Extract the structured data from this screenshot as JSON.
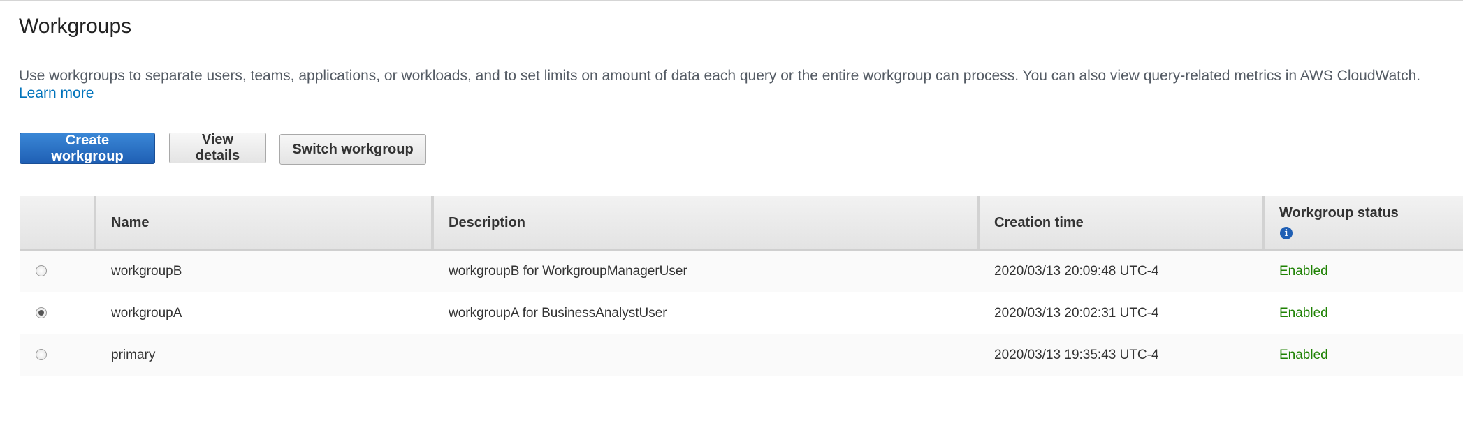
{
  "page": {
    "title": "Workgroups",
    "description": "Use workgroups to separate users, teams, applications, or workloads, and to set limits on amount of data each query or the entire workgroup can process. You can also view query-related metrics in AWS CloudWatch.",
    "learn_more": "Learn more"
  },
  "toolbar": {
    "create_label": "Create workgroup",
    "view_label": "View details",
    "switch_label": "Switch workgroup"
  },
  "table": {
    "columns": [
      "",
      "Name",
      "Description",
      "Creation time",
      "Workgroup status"
    ],
    "info_icon": "info-icon",
    "rows": [
      {
        "selected": false,
        "name": "workgroupB",
        "description": "workgroupB for WorkgroupManagerUser",
        "created": "2020/03/13 20:09:48 UTC-4",
        "status": "Enabled"
      },
      {
        "selected": true,
        "name": "workgroupA",
        "description": "workgroupA for BusinessAnalystUser",
        "created": "2020/03/13 20:02:31 UTC-4",
        "status": "Enabled"
      },
      {
        "selected": false,
        "name": "primary",
        "description": "",
        "created": "2020/03/13 19:35:43 UTC-4",
        "status": "Enabled"
      }
    ]
  },
  "colors": {
    "accent": "#1f5fb4",
    "link": "#0073bb",
    "status_enabled": "#1d8102"
  }
}
